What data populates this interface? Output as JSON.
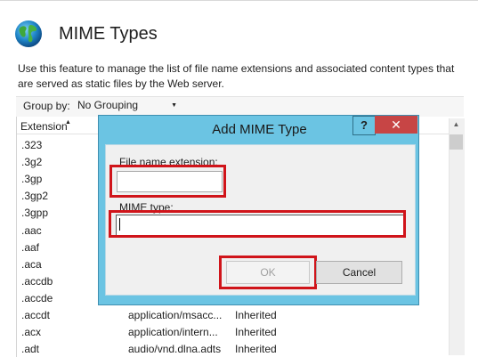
{
  "header": {
    "title": "MIME Types",
    "description": "Use this feature to manage the list of file name extensions and associated content types that are served as static files by the Web server."
  },
  "groupbar": {
    "label": "Group by:",
    "selected": "No Grouping"
  },
  "list": {
    "columns": {
      "extension": "Extension"
    },
    "rows": [
      {
        "ext": ".323",
        "mime": "",
        "entry": ""
      },
      {
        "ext": ".3g2",
        "mime": "",
        "entry": ""
      },
      {
        "ext": ".3gp",
        "mime": "",
        "entry": ""
      },
      {
        "ext": ".3gp2",
        "mime": "",
        "entry": ""
      },
      {
        "ext": ".3gpp",
        "mime": "",
        "entry": ""
      },
      {
        "ext": ".aac",
        "mime": "",
        "entry": ""
      },
      {
        "ext": ".aaf",
        "mime": "",
        "entry": ""
      },
      {
        "ext": ".aca",
        "mime": "",
        "entry": ""
      },
      {
        "ext": ".accdb",
        "mime": "",
        "entry": ""
      },
      {
        "ext": ".accde",
        "mime": "",
        "entry": ""
      },
      {
        "ext": ".accdt",
        "mime": "application/msacc...",
        "entry": "Inherited"
      },
      {
        "ext": ".acx",
        "mime": "application/intern...",
        "entry": "Inherited"
      },
      {
        "ext": ".adt",
        "mime": "audio/vnd.dlna.adts",
        "entry": "Inherited"
      }
    ]
  },
  "dialog": {
    "title": "Add MIME Type",
    "help": "?",
    "close": "✕",
    "extension_label": "File name extension:",
    "extension_value": "",
    "mime_label": "MIME type:",
    "mime_value": "",
    "ok_label": "OK",
    "cancel_label": "Cancel"
  },
  "icons": {
    "app": "globe-icon",
    "help": "help-icon",
    "close": "close-icon",
    "dropdown": "chevron-down-icon",
    "sort": "sort-ascending-icon"
  },
  "colors": {
    "dialog_frame": "#6bc4e3",
    "highlight": "#d0141a",
    "close": "#c74545"
  }
}
